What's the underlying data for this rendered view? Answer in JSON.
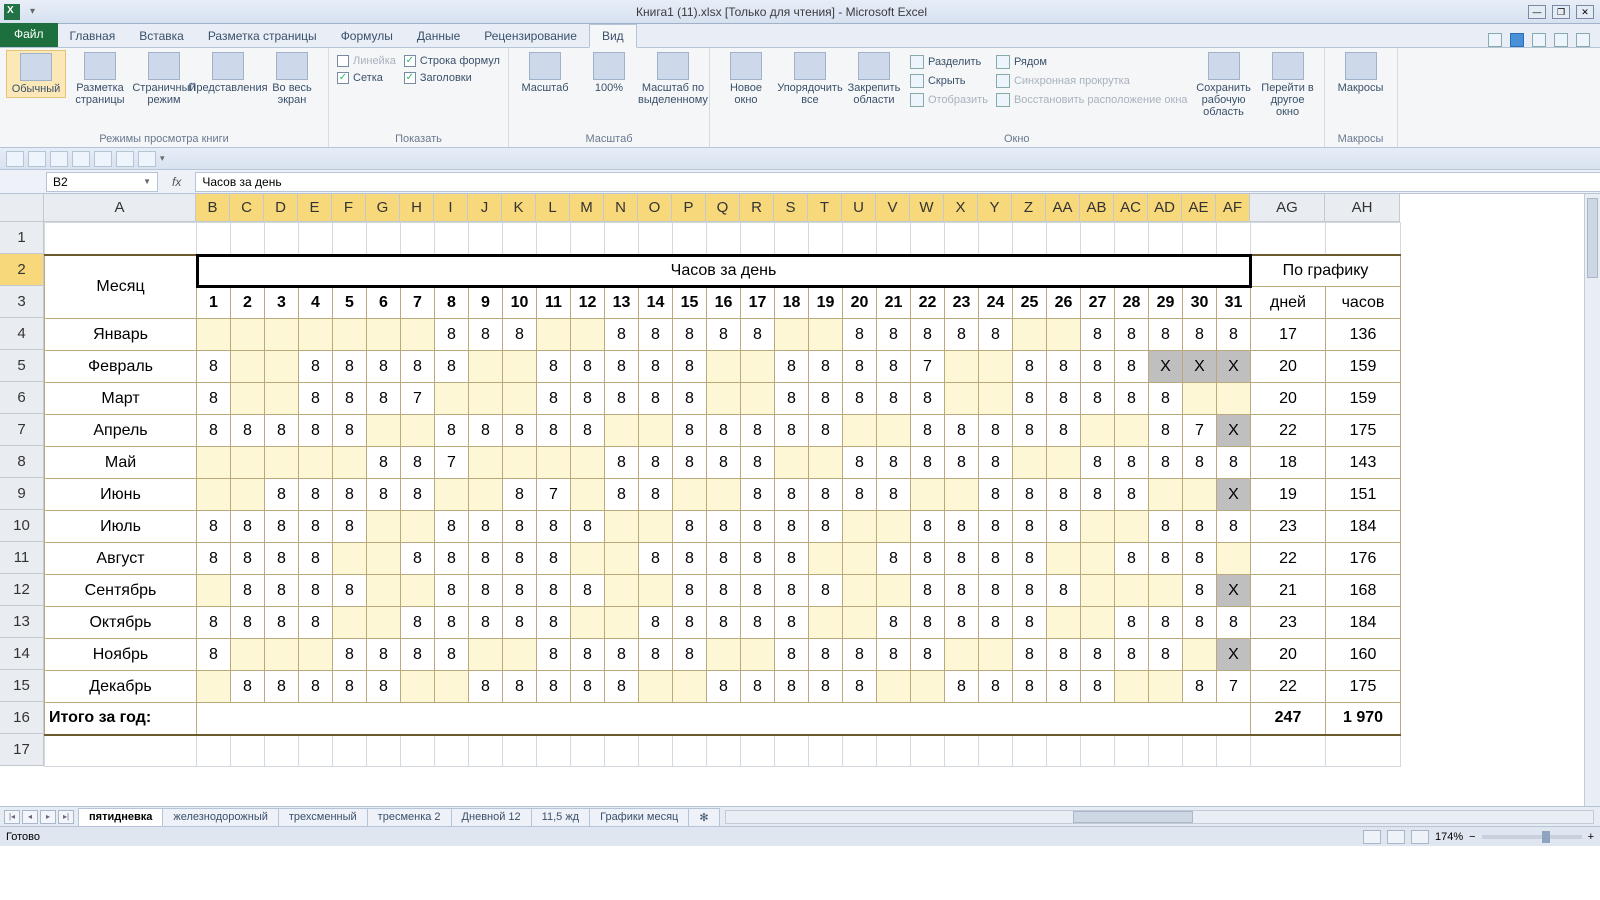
{
  "app": {
    "title": "Книга1 (11).xlsx  [Только для чтения]  -  Microsoft Excel"
  },
  "tabs": {
    "file": "Файл",
    "items": [
      "Главная",
      "Вставка",
      "Разметка страницы",
      "Формулы",
      "Данные",
      "Рецензирование",
      "Вид"
    ],
    "active": "Вид"
  },
  "ribbon": {
    "g1": {
      "label": "Режимы просмотра книги",
      "normal": "Обычный",
      "pagelayout": "Разметка страницы",
      "pagebreak": "Страничный режим",
      "views": "Представления",
      "fullscreen": "Во весь экран"
    },
    "g2": {
      "label": "Показать",
      "ruler": "Линейка",
      "formula": "Строка формул",
      "grid": "Сетка",
      "headings": "Заголовки"
    },
    "g3": {
      "label": "Масштаб",
      "zoom": "Масштаб",
      "p100": "100%",
      "zoomsel": "Масштаб по выделенному"
    },
    "g4": {
      "label": "Окно",
      "newwin": "Новое окно",
      "arrange": "Упорядочить все",
      "freeze": "Закрепить области",
      "split": "Разделить",
      "hide": "Скрыть",
      "unhide": "Отобразить",
      "side": "Рядом",
      "sync": "Синхронная прокрутка",
      "reset": "Восстановить расположение окна",
      "savews": "Сохранить рабочую область",
      "switch": "Перейти в другое окно"
    },
    "g5": {
      "label": "Макросы",
      "macros": "Макросы"
    }
  },
  "namebox": "B2",
  "formula": "Часов за день",
  "columns": [
    "A",
    "B",
    "C",
    "D",
    "E",
    "F",
    "G",
    "H",
    "I",
    "J",
    "K",
    "L",
    "M",
    "N",
    "O",
    "P",
    "Q",
    "R",
    "S",
    "T",
    "U",
    "V",
    "W",
    "X",
    "Y",
    "Z",
    "AA",
    "AB",
    "AC",
    "AD",
    "AE",
    "AF",
    "AG",
    "AH"
  ],
  "col_widths": {
    "A": 152,
    "day": 34,
    "AG": 75,
    "AH": 75
  },
  "headers": {
    "month": "Месяц",
    "hoursday": "Часов за день",
    "schedule": "По графику",
    "days": "дней",
    "hours": "часов"
  },
  "daynums": [
    "1",
    "2",
    "3",
    "4",
    "5",
    "6",
    "7",
    "8",
    "9",
    "10",
    "11",
    "12",
    "13",
    "14",
    "15",
    "16",
    "17",
    "18",
    "19",
    "20",
    "21",
    "22",
    "23",
    "24",
    "25",
    "26",
    "27",
    "28",
    "29",
    "30",
    "31"
  ],
  "rows": [
    {
      "m": "Январь",
      "d": [
        "",
        "",
        "",
        "",
        "",
        "",
        "",
        "8",
        "8",
        "8",
        "",
        "",
        "8",
        "8",
        "8",
        "8",
        "8",
        "",
        "",
        "8",
        "8",
        "8",
        "8",
        "8",
        "",
        "",
        "8",
        "8",
        "8",
        "8",
        "8"
      ],
      "days": "17",
      "hrs": "136"
    },
    {
      "m": "Февраль",
      "d": [
        "8",
        "",
        "",
        "8",
        "8",
        "8",
        "8",
        "8",
        "",
        "",
        "8",
        "8",
        "8",
        "8",
        "8",
        "",
        "",
        "8",
        "8",
        "8",
        "8",
        "7",
        "",
        "",
        "8",
        "8",
        "8",
        "8",
        "X",
        "X",
        "X"
      ],
      "days": "20",
      "hrs": "159"
    },
    {
      "m": "Март",
      "d": [
        "8",
        "",
        "",
        "8",
        "8",
        "8",
        "7",
        "",
        "",
        "",
        "8",
        "8",
        "8",
        "8",
        "8",
        "",
        "",
        "8",
        "8",
        "8",
        "8",
        "8",
        "",
        "",
        "8",
        "8",
        "8",
        "8",
        "8",
        "",
        ""
      ],
      "days": "20",
      "hrs": "159"
    },
    {
      "m": "Апрель",
      "d": [
        "8",
        "8",
        "8",
        "8",
        "8",
        "",
        "",
        "8",
        "8",
        "8",
        "8",
        "8",
        "",
        "",
        "8",
        "8",
        "8",
        "8",
        "8",
        "",
        "",
        "8",
        "8",
        "8",
        "8",
        "8",
        "",
        "",
        "8",
        "7",
        "X"
      ],
      "days": "22",
      "hrs": "175"
    },
    {
      "m": "Май",
      "d": [
        "",
        "",
        "",
        "",
        "",
        "8",
        "8",
        "7",
        "",
        "",
        "",
        "",
        "8",
        "8",
        "8",
        "8",
        "8",
        "",
        "",
        "8",
        "8",
        "8",
        "8",
        "8",
        "",
        "",
        "8",
        "8",
        "8",
        "8",
        "8"
      ],
      "days": "18",
      "hrs": "143"
    },
    {
      "m": "Июнь",
      "d": [
        "",
        "",
        "8",
        "8",
        "8",
        "8",
        "8",
        "",
        "",
        "8",
        "7",
        "",
        "8",
        "8",
        "",
        "",
        "8",
        "8",
        "8",
        "8",
        "8",
        "",
        "",
        "8",
        "8",
        "8",
        "8",
        "8",
        "",
        "",
        "X"
      ],
      "days": "19",
      "hrs": "151"
    },
    {
      "m": "Июль",
      "d": [
        "8",
        "8",
        "8",
        "8",
        "8",
        "",
        "",
        "8",
        "8",
        "8",
        "8",
        "8",
        "",
        "",
        "8",
        "8",
        "8",
        "8",
        "8",
        "",
        "",
        "8",
        "8",
        "8",
        "8",
        "8",
        "",
        "",
        "8",
        "8",
        "8"
      ],
      "days": "23",
      "hrs": "184"
    },
    {
      "m": "Август",
      "d": [
        "8",
        "8",
        "8",
        "8",
        "",
        "",
        "8",
        "8",
        "8",
        "8",
        "8",
        "",
        "",
        "8",
        "8",
        "8",
        "8",
        "8",
        "",
        "",
        "8",
        "8",
        "8",
        "8",
        "8",
        "",
        "",
        "8",
        "8",
        "8",
        ""
      ],
      "days": "22",
      "hrs": "176"
    },
    {
      "m": "Сентябрь",
      "d": [
        "",
        "8",
        "8",
        "8",
        "8",
        "",
        "",
        "8",
        "8",
        "8",
        "8",
        "8",
        "",
        "",
        "8",
        "8",
        "8",
        "8",
        "8",
        "",
        "",
        "8",
        "8",
        "8",
        "8",
        "8",
        "",
        "",
        "",
        "8",
        "X"
      ],
      "days": "21",
      "hrs": "168"
    },
    {
      "m": "Октябрь",
      "d": [
        "8",
        "8",
        "8",
        "8",
        "",
        "",
        "8",
        "8",
        "8",
        "8",
        "8",
        "",
        "",
        "8",
        "8",
        "8",
        "8",
        "8",
        "",
        "",
        "8",
        "8",
        "8",
        "8",
        "8",
        "",
        "",
        "8",
        "8",
        "8",
        "8"
      ],
      "days": "23",
      "hrs": "184"
    },
    {
      "m": "Ноябрь",
      "d": [
        "8",
        "",
        "",
        "",
        "8",
        "8",
        "8",
        "8",
        "",
        "",
        "8",
        "8",
        "8",
        "8",
        "8",
        "",
        "",
        "8",
        "8",
        "8",
        "8",
        "8",
        "",
        "",
        "8",
        "8",
        "8",
        "8",
        "8",
        "",
        "X"
      ],
      "days": "20",
      "hrs": "160"
    },
    {
      "m": "Декабрь",
      "d": [
        "",
        "8",
        "8",
        "8",
        "8",
        "8",
        "",
        "",
        "8",
        "8",
        "8",
        "8",
        "8",
        "",
        "",
        "8",
        "8",
        "8",
        "8",
        "8",
        "",
        "",
        "8",
        "8",
        "8",
        "8",
        "8",
        "",
        "",
        "8",
        "7"
      ],
      "days": "22",
      "hrs": "175"
    }
  ],
  "total": {
    "label": "Итого за год:",
    "days": "247",
    "hours": "1 970"
  },
  "sheets": {
    "items": [
      "пятидневка",
      "железнодорожный",
      "трехсменный",
      "тресменка 2",
      "Дневной 12",
      "11,5 жд",
      "Графики месяц"
    ],
    "active": "пятидневка"
  },
  "status": {
    "ready": "Готово",
    "zoom": "174%"
  }
}
